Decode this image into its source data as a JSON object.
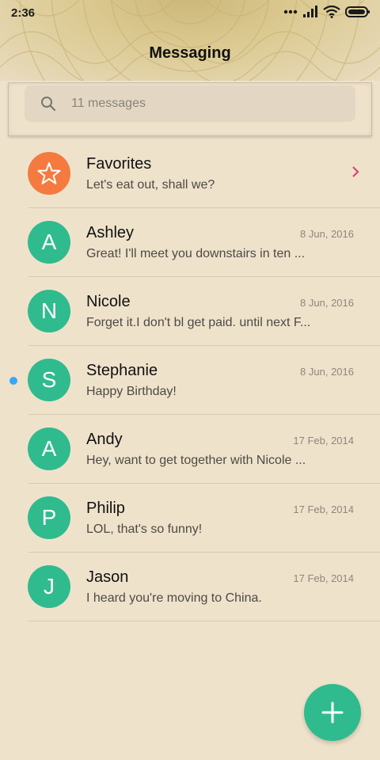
{
  "status_bar": {
    "time": "2:36"
  },
  "header": {
    "title": "Messaging"
  },
  "search": {
    "placeholder": "11 messages"
  },
  "colors": {
    "accent": "#2fbb8e",
    "favorites": "#f57a3f",
    "unread": "#36a8f4",
    "chevron": "#e0407a"
  },
  "conversations": [
    {
      "name": "Favorites",
      "preview": "Let's eat out, shall we?",
      "date": "",
      "avatar": "star-icon",
      "type": "favorites"
    },
    {
      "name": "Ashley",
      "preview": "Great! I'll meet you downstairs in ten ...",
      "date": "8 Jun, 2016",
      "avatar": "A"
    },
    {
      "name": "Nicole",
      "preview": "Forget it.I don't bl get paid. until next F...",
      "date": "8 Jun, 2016",
      "avatar": "N"
    },
    {
      "name": "Stephanie",
      "preview": "Happy Birthday!",
      "date": "8 Jun, 2016",
      "avatar": "S",
      "unread": true
    },
    {
      "name": "Andy",
      "preview": "Hey, want to get together with Nicole ...",
      "date": "17 Feb, 2014",
      "avatar": "A"
    },
    {
      "name": "Philip",
      "preview": "LOL, that's so funny!",
      "date": "17 Feb, 2014",
      "avatar": "P"
    },
    {
      "name": "Jason",
      "preview": "I heard you're moving to China.",
      "date": "17 Feb, 2014",
      "avatar": "J"
    }
  ],
  "fab": {
    "icon": "plus-icon"
  }
}
